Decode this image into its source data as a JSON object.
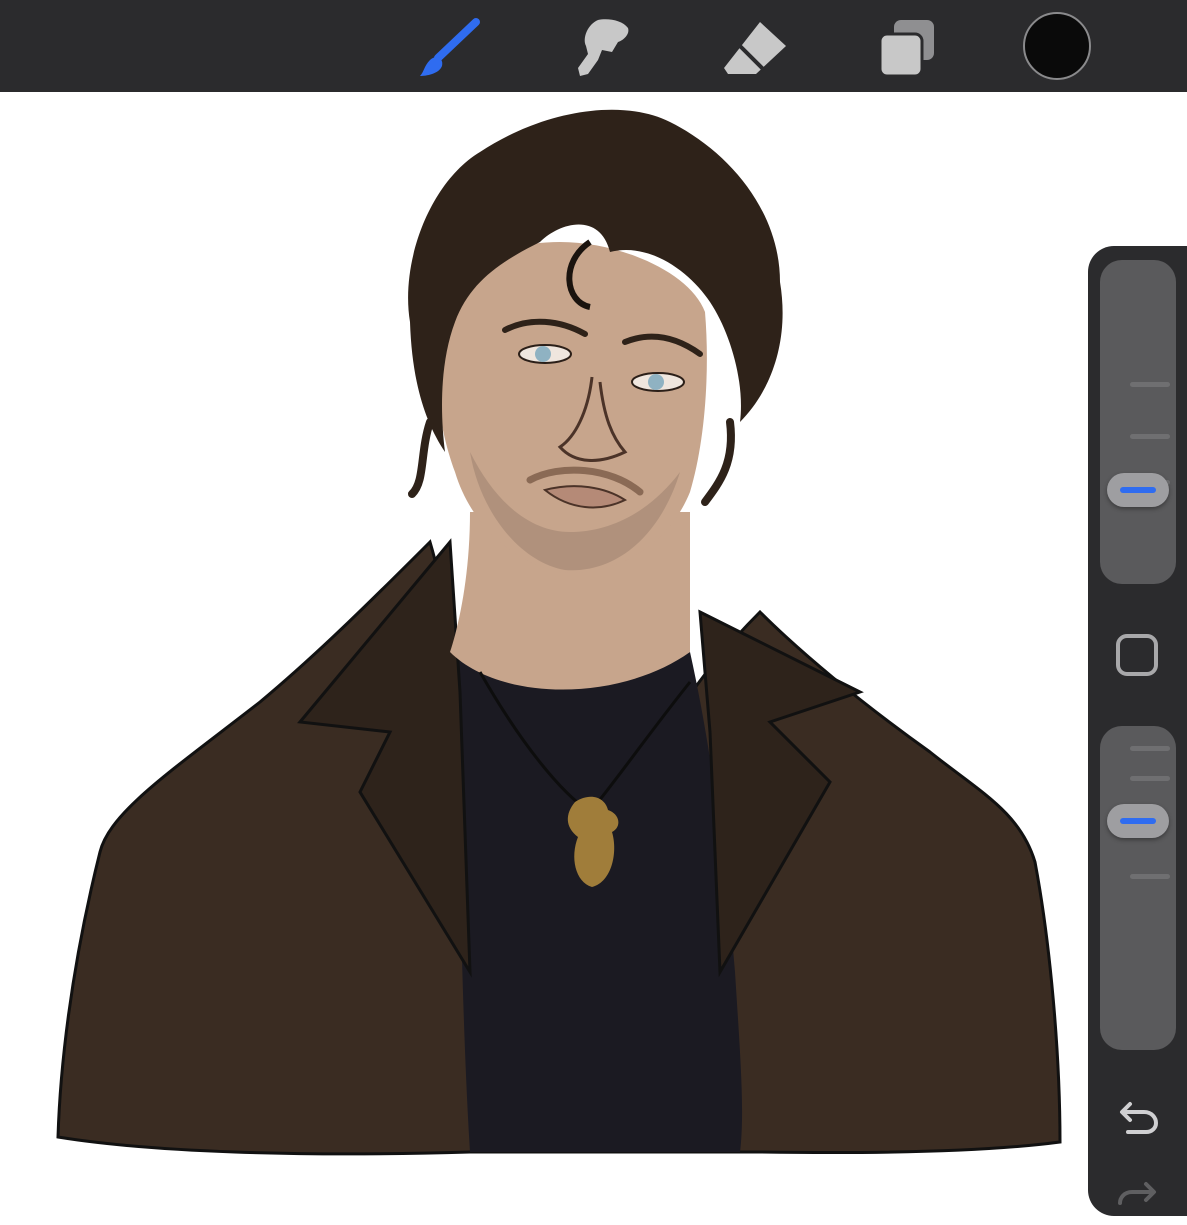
{
  "toolbar": {
    "tools": [
      {
        "name": "brush-icon",
        "active": true
      },
      {
        "name": "smudge-icon",
        "active": false
      },
      {
        "name": "eraser-icon",
        "active": false
      },
      {
        "name": "layers-icon",
        "active": false
      }
    ],
    "active_color": "#0a0a0a",
    "accent_color": "#2f6cf0"
  },
  "sidebar": {
    "brush_size": 0.25,
    "opacity": 0.75,
    "undo_icon": "undo-icon",
    "redo_icon": "redo-icon",
    "modify_icon": "square-icon"
  },
  "canvas": {
    "palette": {
      "hair": "#2e2219",
      "skin": "#c7a58c",
      "jacket": "#3a2c22",
      "shirt": "#1b1a22",
      "pendant": "#a07d3a",
      "eyes": "#8fb2c2"
    }
  }
}
